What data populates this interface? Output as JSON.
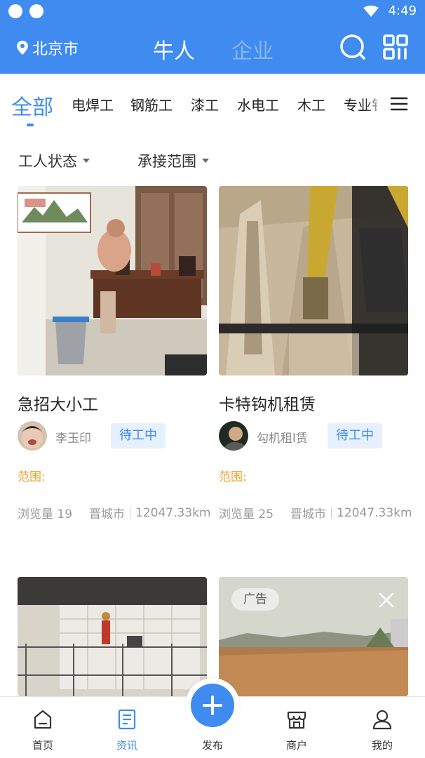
{
  "status": {
    "time": "4:49"
  },
  "header": {
    "location": "北京市",
    "tabs": [
      {
        "label": "牛人",
        "active": true
      },
      {
        "label": "企业",
        "active": false
      }
    ],
    "icons": [
      "search-icon",
      "grid-icon"
    ]
  },
  "categories": {
    "items": [
      {
        "label": "全部",
        "active": true
      },
      {
        "label": "电焊工"
      },
      {
        "label": "钢筋工"
      },
      {
        "label": "漆工"
      },
      {
        "label": "水电工"
      },
      {
        "label": "木工"
      },
      {
        "label": "专业钅"
      }
    ]
  },
  "filters": {
    "status_label": "工人状态",
    "range_label": "承接范围"
  },
  "cards": [
    {
      "title": "急招大小工",
      "user": "李玉印",
      "badge": "待工中",
      "range_label": "范围:",
      "views": "浏览量 19",
      "city": "晋城市",
      "distance": "12047.33km"
    },
    {
      "title": "卡特钩机租赁",
      "user": "勾机租l赁",
      "badge": "待工中",
      "range_label": "范围:",
      "views": "浏览量 25",
      "city": "晋城市",
      "distance": "12047.33km"
    }
  ],
  "ad": {
    "tag": "广告"
  },
  "bottom_nav": [
    {
      "label": "首页",
      "icon": "home-icon"
    },
    {
      "label": "资讯",
      "icon": "news-icon",
      "active": true
    },
    {
      "label": "发布",
      "icon": "plus-icon"
    },
    {
      "label": "商户",
      "icon": "store-icon"
    },
    {
      "label": "我的",
      "icon": "user-icon"
    }
  ],
  "colors": {
    "primary": "#3f8bf0",
    "range": "#f0a030",
    "badge_bg": "#e6f0fe"
  }
}
